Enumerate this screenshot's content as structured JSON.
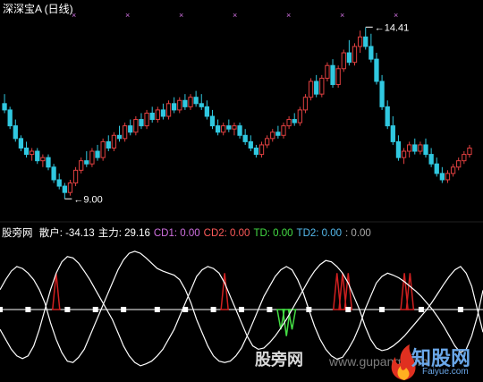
{
  "window": {
    "title": "深深宝A (日线)"
  },
  "price_labels": {
    "high": "14.41",
    "low": "9.00"
  },
  "indicator": {
    "name": "股旁网",
    "items": [
      {
        "label": "散户:",
        "value": "-34.13",
        "color": "#ffffff"
      },
      {
        "label": "主力:",
        "value": "29.16",
        "color": "#ffffff"
      },
      {
        "label": "CD1:",
        "value": "0.00",
        "color": "#d070e0"
      },
      {
        "label": "CD2:",
        "value": "0.00",
        "color": "#ff5a5a"
      },
      {
        "label": "TD:",
        "value": "0.00",
        "color": "#44dd44"
      },
      {
        "label": "TD2:",
        "value": "0.00",
        "color": "#55bbee"
      },
      {
        "label": ":",
        "value": "0.00",
        "color": "#aaaaaa"
      }
    ]
  },
  "watermark": {
    "text": "股旁网",
    "url": "www.gupang.com",
    "logo_main": "知股网",
    "logo_sub": "Faiyue.com"
  },
  "colors": {
    "up": "#e04040",
    "down": "#30c8e0",
    "white": "#ffffff",
    "magenta": "#d070e0",
    "green": "#44dd44",
    "red": "#d02020"
  },
  "chart_data": [
    {
      "type": "candlestick",
      "title": "深深宝A (日线)",
      "ylim": [
        8.5,
        14.7
      ],
      "candles": [
        [
          12.0,
          12.3,
          11.7,
          11.8
        ],
        [
          11.8,
          11.9,
          11.2,
          11.3
        ],
        [
          11.3,
          11.5,
          10.8,
          10.9
        ],
        [
          10.9,
          11.0,
          10.5,
          10.6
        ],
        [
          10.6,
          10.8,
          10.3,
          10.4
        ],
        [
          10.4,
          10.6,
          10.2,
          10.5
        ],
        [
          10.5,
          10.6,
          10.1,
          10.2
        ],
        [
          10.2,
          10.4,
          10.0,
          10.3
        ],
        [
          10.3,
          10.4,
          9.9,
          10.0
        ],
        [
          10.0,
          10.1,
          9.5,
          9.6
        ],
        [
          9.6,
          9.8,
          9.3,
          9.4
        ],
        [
          9.4,
          9.5,
          9.0,
          9.2
        ],
        [
          9.2,
          9.6,
          9.1,
          9.5
        ],
        [
          9.5,
          10.0,
          9.4,
          9.9
        ],
        [
          9.9,
          10.3,
          9.8,
          10.2
        ],
        [
          10.2,
          10.5,
          10.0,
          10.1
        ],
        [
          10.1,
          10.6,
          10.0,
          10.5
        ],
        [
          10.5,
          10.7,
          10.2,
          10.3
        ],
        [
          10.3,
          10.9,
          10.2,
          10.8
        ],
        [
          10.8,
          11.0,
          10.5,
          10.6
        ],
        [
          10.6,
          11.1,
          10.5,
          11.0
        ],
        [
          11.0,
          11.3,
          10.8,
          10.9
        ],
        [
          10.9,
          11.4,
          10.8,
          11.3
        ],
        [
          11.3,
          11.5,
          11.0,
          11.1
        ],
        [
          11.1,
          11.6,
          11.0,
          11.5
        ],
        [
          11.5,
          11.7,
          11.2,
          11.3
        ],
        [
          11.3,
          11.8,
          11.2,
          11.7
        ],
        [
          11.7,
          11.9,
          11.4,
          11.5
        ],
        [
          11.5,
          11.9,
          11.4,
          11.8
        ],
        [
          11.8,
          12.0,
          11.5,
          11.6
        ],
        [
          11.6,
          12.1,
          11.5,
          12.0
        ],
        [
          12.0,
          12.2,
          11.7,
          11.8
        ],
        [
          11.8,
          12.2,
          11.7,
          12.1
        ],
        [
          12.1,
          12.3,
          11.8,
          11.9
        ],
        [
          11.9,
          12.3,
          11.8,
          12.2
        ],
        [
          12.2,
          12.4,
          11.9,
          12.0
        ],
        [
          12.0,
          12.3,
          11.8,
          11.9
        ],
        [
          11.9,
          12.1,
          11.5,
          11.6
        ],
        [
          11.6,
          11.8,
          11.2,
          11.3
        ],
        [
          11.3,
          11.5,
          11.0,
          11.1
        ],
        [
          11.1,
          11.4,
          11.0,
          11.3
        ],
        [
          11.3,
          11.5,
          11.1,
          11.2
        ],
        [
          11.2,
          11.4,
          11.0,
          11.3
        ],
        [
          11.3,
          11.4,
          10.9,
          11.0
        ],
        [
          11.0,
          11.2,
          10.7,
          10.8
        ],
        [
          10.8,
          11.0,
          10.5,
          10.6
        ],
        [
          10.6,
          10.7,
          10.3,
          10.4
        ],
        [
          10.4,
          10.8,
          10.3,
          10.7
        ],
        [
          10.7,
          11.0,
          10.6,
          10.9
        ],
        [
          10.9,
          11.2,
          10.8,
          11.1
        ],
        [
          11.1,
          11.3,
          10.9,
          11.0
        ],
        [
          11.0,
          11.4,
          10.9,
          11.3
        ],
        [
          11.3,
          11.6,
          11.2,
          11.5
        ],
        [
          11.5,
          11.7,
          11.3,
          11.4
        ],
        [
          11.4,
          11.9,
          11.3,
          11.8
        ],
        [
          11.8,
          12.3,
          11.7,
          12.2
        ],
        [
          12.2,
          12.8,
          12.1,
          12.7
        ],
        [
          12.7,
          12.9,
          12.2,
          12.3
        ],
        [
          12.3,
          12.9,
          12.2,
          12.8
        ],
        [
          12.8,
          13.3,
          12.7,
          13.2
        ],
        [
          13.2,
          13.4,
          12.5,
          12.6
        ],
        [
          12.6,
          13.2,
          12.5,
          13.1
        ],
        [
          13.1,
          13.7,
          13.0,
          13.6
        ],
        [
          13.6,
          14.0,
          13.2,
          13.3
        ],
        [
          13.3,
          13.9,
          13.2,
          13.8
        ],
        [
          13.8,
          14.3,
          13.6,
          14.1
        ],
        [
          14.1,
          14.4,
          13.7,
          13.8
        ],
        [
          13.8,
          14.2,
          13.3,
          13.4
        ],
        [
          13.4,
          13.6,
          12.6,
          12.7
        ],
        [
          12.7,
          12.9,
          11.8,
          11.9
        ],
        [
          11.9,
          12.1,
          11.2,
          11.3
        ],
        [
          11.3,
          11.6,
          10.7,
          10.8
        ],
        [
          10.8,
          11.0,
          10.2,
          10.3
        ],
        [
          10.3,
          10.6,
          10.1,
          10.5
        ],
        [
          10.5,
          10.8,
          10.3,
          10.7
        ],
        [
          10.7,
          10.9,
          10.4,
          10.5
        ],
        [
          10.5,
          10.8,
          10.4,
          10.7
        ],
        [
          10.7,
          10.9,
          10.3,
          10.4
        ],
        [
          10.4,
          10.6,
          10.0,
          10.1
        ],
        [
          10.1,
          10.3,
          9.7,
          9.8
        ],
        [
          9.8,
          10.0,
          9.5,
          9.6
        ],
        [
          9.6,
          9.9,
          9.5,
          9.8
        ],
        [
          9.8,
          10.1,
          9.7,
          10.0
        ],
        [
          10.0,
          10.3,
          9.9,
          10.2
        ],
        [
          10.2,
          10.5,
          10.1,
          10.4
        ],
        [
          10.4,
          10.7,
          10.3,
          10.6
        ]
      ],
      "annotations": [
        {
          "label": "14.41",
          "at_candle": 66,
          "value": 14.41
        },
        {
          "label": "9.00",
          "at_candle": 11,
          "value": 9.0
        }
      ]
    },
    {
      "type": "line",
      "title": "股旁网",
      "ylim": [
        -100,
        100
      ],
      "baseline": 0,
      "series": [
        {
          "name": "散户",
          "color": "#ffffff",
          "values": [
            -30,
            -45,
            -60,
            -70,
            -74,
            -70,
            -55,
            -30,
            0,
            30,
            55,
            72,
            80,
            78,
            70,
            58,
            45,
            30,
            15,
            0,
            -15,
            -35,
            -55,
            -70,
            -80,
            -85,
            -82,
            -78,
            -70,
            -60,
            -45,
            -30,
            -10,
            10,
            30,
            50,
            60,
            65,
            62,
            55,
            40,
            20,
            0,
            -20,
            -40,
            -55,
            -60,
            -58,
            -50,
            -40,
            -28,
            -15,
            0,
            15,
            30,
            45,
            58,
            68,
            74,
            72,
            65,
            55,
            40,
            20,
            0,
            -25,
            -45,
            -58,
            -62,
            -60,
            -55,
            -48,
            -40,
            -30,
            -20,
            -10,
            0,
            12,
            25,
            38,
            50,
            60,
            65,
            55,
            35,
            0,
            -34.13
          ]
        },
        {
          "name": "主力",
          "color": "#ffffff",
          "values": [
            30,
            45,
            58,
            65,
            62,
            55,
            45,
            30,
            10,
            -20,
            -45,
            -65,
            -78,
            -80,
            -72,
            -60,
            -40,
            -20,
            0,
            20,
            40,
            60,
            75,
            85,
            88,
            85,
            78,
            70,
            62,
            58,
            55,
            52,
            45,
            30,
            10,
            -15,
            -35,
            -55,
            -70,
            -78,
            -80,
            -78,
            -70,
            -58,
            -40,
            -20,
            0,
            20,
            35,
            50,
            60,
            65,
            60,
            45,
            25,
            0,
            -25,
            -45,
            -60,
            -70,
            -75,
            -72,
            -60,
            -45,
            -25,
            0,
            20,
            40,
            50,
            55,
            52,
            48,
            42,
            35,
            28,
            20,
            10,
            0,
            -12,
            -25,
            -40,
            -55,
            -65,
            -60,
            -40,
            -10,
            29.16
          ]
        },
        {
          "name": "CD1",
          "color": "#d070e0",
          "values": []
        },
        {
          "name": "CD2",
          "color": "#ff5a5a",
          "values": []
        },
        {
          "name": "TD",
          "color": "#44dd44",
          "values": []
        },
        {
          "name": "TD2",
          "color": "#55bbee",
          "values": []
        }
      ],
      "signal_spikes": [
        {
          "color": "#d02020",
          "at_index": 10,
          "height": 55
        },
        {
          "color": "#d02020",
          "at_index": 40,
          "height": 55
        },
        {
          "color": "#d02020",
          "at_index": 60,
          "height": 55
        },
        {
          "color": "#d02020",
          "at_index": 61,
          "height": 55
        },
        {
          "color": "#d02020",
          "at_index": 62,
          "height": 55
        },
        {
          "color": "#d02020",
          "at_index": 72,
          "height": 55
        },
        {
          "color": "#d02020",
          "at_index": 73,
          "height": 55
        },
        {
          "color": "#44dd44",
          "at_index": 50,
          "height": -30
        },
        {
          "color": "#44dd44",
          "at_index": 51,
          "height": -40
        },
        {
          "color": "#44dd44",
          "at_index": 52,
          "height": -30
        }
      ],
      "baseline_dots": [
        0,
        5,
        12,
        17,
        22,
        28,
        33,
        38,
        43,
        48,
        55,
        62,
        68,
        75,
        82
      ]
    }
  ]
}
